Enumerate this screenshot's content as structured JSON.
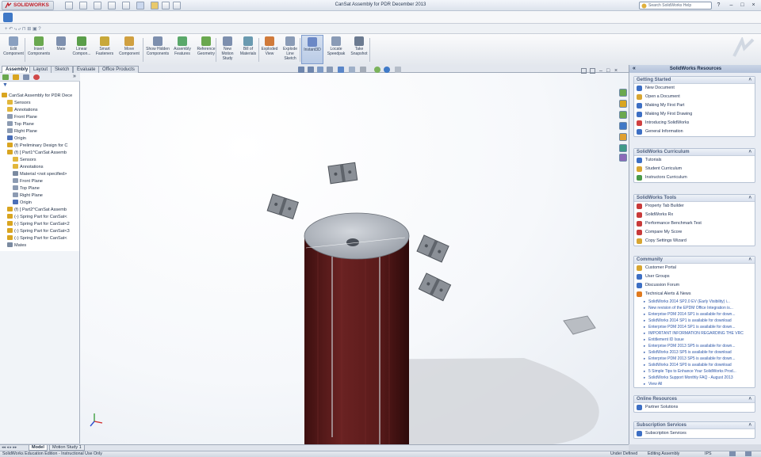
{
  "app": {
    "brand": "SOLIDWORKS",
    "window_title": "CanSat Assembly for PDR December 2013"
  },
  "search": {
    "placeholder": "Search SolidWorks Help"
  },
  "window_controls": {
    "min": "–",
    "max": "□",
    "close": "×"
  },
  "commands": [
    {
      "label": "Edit Component",
      "icon": "edit-component-icon",
      "active": false
    },
    {
      "label": "Insert Components",
      "icon": "insert-components-icon",
      "active": false
    },
    {
      "label": "Mate",
      "icon": "mate-icon",
      "active": false
    },
    {
      "label": "Linear Compon...",
      "icon": "linear-pattern-icon",
      "active": false
    },
    {
      "label": "Smart Fasteners",
      "icon": "smart-fasteners-icon",
      "active": false
    },
    {
      "label": "Move Component",
      "icon": "move-component-icon",
      "active": false
    },
    {
      "label": "Show Hidden Components",
      "icon": "show-hidden-icon",
      "active": false
    },
    {
      "label": "Assembly Features",
      "icon": "assembly-features-icon",
      "active": false
    },
    {
      "label": "Reference Geometry",
      "icon": "reference-geometry-icon",
      "active": false
    },
    {
      "label": "New Motion Study",
      "icon": "motion-study-icon",
      "active": false
    },
    {
      "label": "Bill of Materials",
      "icon": "bill-of-materials-icon",
      "active": false
    },
    {
      "label": "Exploded View",
      "icon": "exploded-view-icon",
      "active": false
    },
    {
      "label": "Explode Line Sketch",
      "icon": "explode-line-icon",
      "active": false
    },
    {
      "label": "Instant3D",
      "icon": "instant3d-icon",
      "active": true
    },
    {
      "label": "Locate Speedpak",
      "icon": "speedpak-icon",
      "active": false
    },
    {
      "label": "Take Snapshot",
      "icon": "snapshot-icon",
      "active": false
    }
  ],
  "tabs": [
    "Assembly",
    "Layout",
    "Sketch",
    "Evaluate",
    "Office Products"
  ],
  "tree": [
    {
      "label": "CanSat Assembly for PDR Dece",
      "level": 0,
      "color": "#d9a520"
    },
    {
      "label": "Sensors",
      "level": 1,
      "color": "#e2b73c"
    },
    {
      "label": "Annotations",
      "level": 1,
      "color": "#e2b73c"
    },
    {
      "label": "Front Plane",
      "level": 1,
      "color": "#8c9bb2"
    },
    {
      "label": "Top Plane",
      "level": 1,
      "color": "#8c9bb2"
    },
    {
      "label": "Right Plane",
      "level": 1,
      "color": "#8c9bb2"
    },
    {
      "label": "Origin",
      "level": 1,
      "color": "#4b6fb8"
    },
    {
      "label": "(f) Preliminary Design for C",
      "level": 1,
      "color": "#d9a520"
    },
    {
      "label": "(f) [ Part1^CanSat Assemb",
      "level": 1,
      "color": "#d9a520"
    },
    {
      "label": "Sensors",
      "level": 2,
      "color": "#e2b73c"
    },
    {
      "label": "Annotations",
      "level": 2,
      "color": "#e2b73c"
    },
    {
      "label": "Material <not specified>",
      "level": 2,
      "color": "#7a8aa0"
    },
    {
      "label": "Front Plane",
      "level": 2,
      "color": "#8c9bb2"
    },
    {
      "label": "Top Plane",
      "level": 2,
      "color": "#8c9bb2"
    },
    {
      "label": "Right Plane",
      "level": 2,
      "color": "#8c9bb2"
    },
    {
      "label": "Origin",
      "level": 2,
      "color": "#4b6fb8"
    },
    {
      "label": "(f) [ Part2^CanSat Assemb",
      "level": 1,
      "color": "#d9a520"
    },
    {
      "label": "(-) Spring Part for CanSat<",
      "level": 1,
      "color": "#d9a520"
    },
    {
      "label": "(-) Spring Part for CanSat<2",
      "level": 1,
      "color": "#d9a520"
    },
    {
      "label": "(-) Spring Part for CanSat<3",
      "level": 1,
      "color": "#d9a520"
    },
    {
      "label": "(-) Spring Part for CanSat<",
      "level": 1,
      "color": "#d9a520"
    },
    {
      "label": "Mates",
      "level": 1,
      "color": "#7a8aa0"
    }
  ],
  "resources": {
    "title": "SolidWorks Resources",
    "groups": [
      {
        "title": "Getting Started",
        "items": [
          {
            "label": "New Document",
            "color": "#3d6fc4"
          },
          {
            "label": "Open a Document",
            "color": "#d7a531"
          },
          {
            "label": "Making My First Part",
            "color": "#3d6fc4"
          },
          {
            "label": "Making My First Drawing",
            "color": "#3d6fc4"
          },
          {
            "label": "Introducing SolidWorks",
            "color": "#d04040"
          },
          {
            "label": "General Information",
            "color": "#3d6fc4"
          }
        ],
        "subitems": []
      },
      {
        "title": "SolidWorks Curriculum",
        "items": [
          {
            "label": "Tutorials",
            "color": "#3d6fc4"
          },
          {
            "label": "Student Curriculum",
            "color": "#d7a531"
          },
          {
            "label": "Instructors Curriculum",
            "color": "#4a9a48"
          }
        ],
        "subitems": []
      },
      {
        "title": "SolidWorks Tools",
        "items": [
          {
            "label": "Property Tab Builder",
            "color": "#c83a3a"
          },
          {
            "label": "SolidWorks Rx",
            "color": "#c83a3a"
          },
          {
            "label": "Performance Benchmark Test",
            "color": "#c83a3a"
          },
          {
            "label": "Compare My Score",
            "color": "#c83a3a"
          },
          {
            "label": "Copy Settings Wizard",
            "color": "#d7a531"
          }
        ],
        "subitems": []
      },
      {
        "title": "Community",
        "items": [
          {
            "label": "Customer Portal",
            "color": "#d7a531"
          },
          {
            "label": "User Groups",
            "color": "#3d6fc4"
          },
          {
            "label": "Discussion Forum",
            "color": "#3d6fc4"
          },
          {
            "label": "Technical Alerts & News",
            "color": "#e07a1e"
          }
        ],
        "subitems": [
          "SolidWorks 2014 SP2.0 EV (Early Visibility) i...",
          "New revision of the EPDM Office Integration is...",
          "Enterprise PDM 2014 SP1 is available for down...",
          "SolidWorks 2014 SP1 is available for download",
          "Enterprise PDM 2014 SP1 is available for down...",
          "IMPORTANT INFORMATION REGARDING THE VRC",
          "Entitlement ID Issue",
          "Enterprise PDM 2013 SP5 is available for down...",
          "SolidWorks 2013 SP5 is available for download",
          "Enterprise PDM 2013 SP5 is available for down...",
          "SolidWorks 2014 SP0 is available for download",
          "5 Simple Tips to Enhance Your SolidWorks Prod...",
          "SolidWorks Support Monthly FAQ - August 2013",
          "View All"
        ]
      },
      {
        "title": "Online Resources",
        "items": [
          {
            "label": "Partner Solutions",
            "color": "#3d6fc4"
          }
        ],
        "subitems": []
      },
      {
        "title": "Subscription Services",
        "items": [
          {
            "label": "Subscription Services",
            "color": "#3d6fc4"
          }
        ],
        "subitems": []
      }
    ]
  },
  "bottom_tabs": [
    "Model",
    "Motion Study 1"
  ],
  "status": {
    "left": "SolidWorks Education Edition - Instructional Use Only",
    "state": "Under Defined",
    "mode": "Editing Assembly",
    "units": "IPS"
  },
  "colors": {
    "accent": "#7f9ccc",
    "can_body": "#5a1c1c",
    "lid": "#b0b4ba"
  }
}
